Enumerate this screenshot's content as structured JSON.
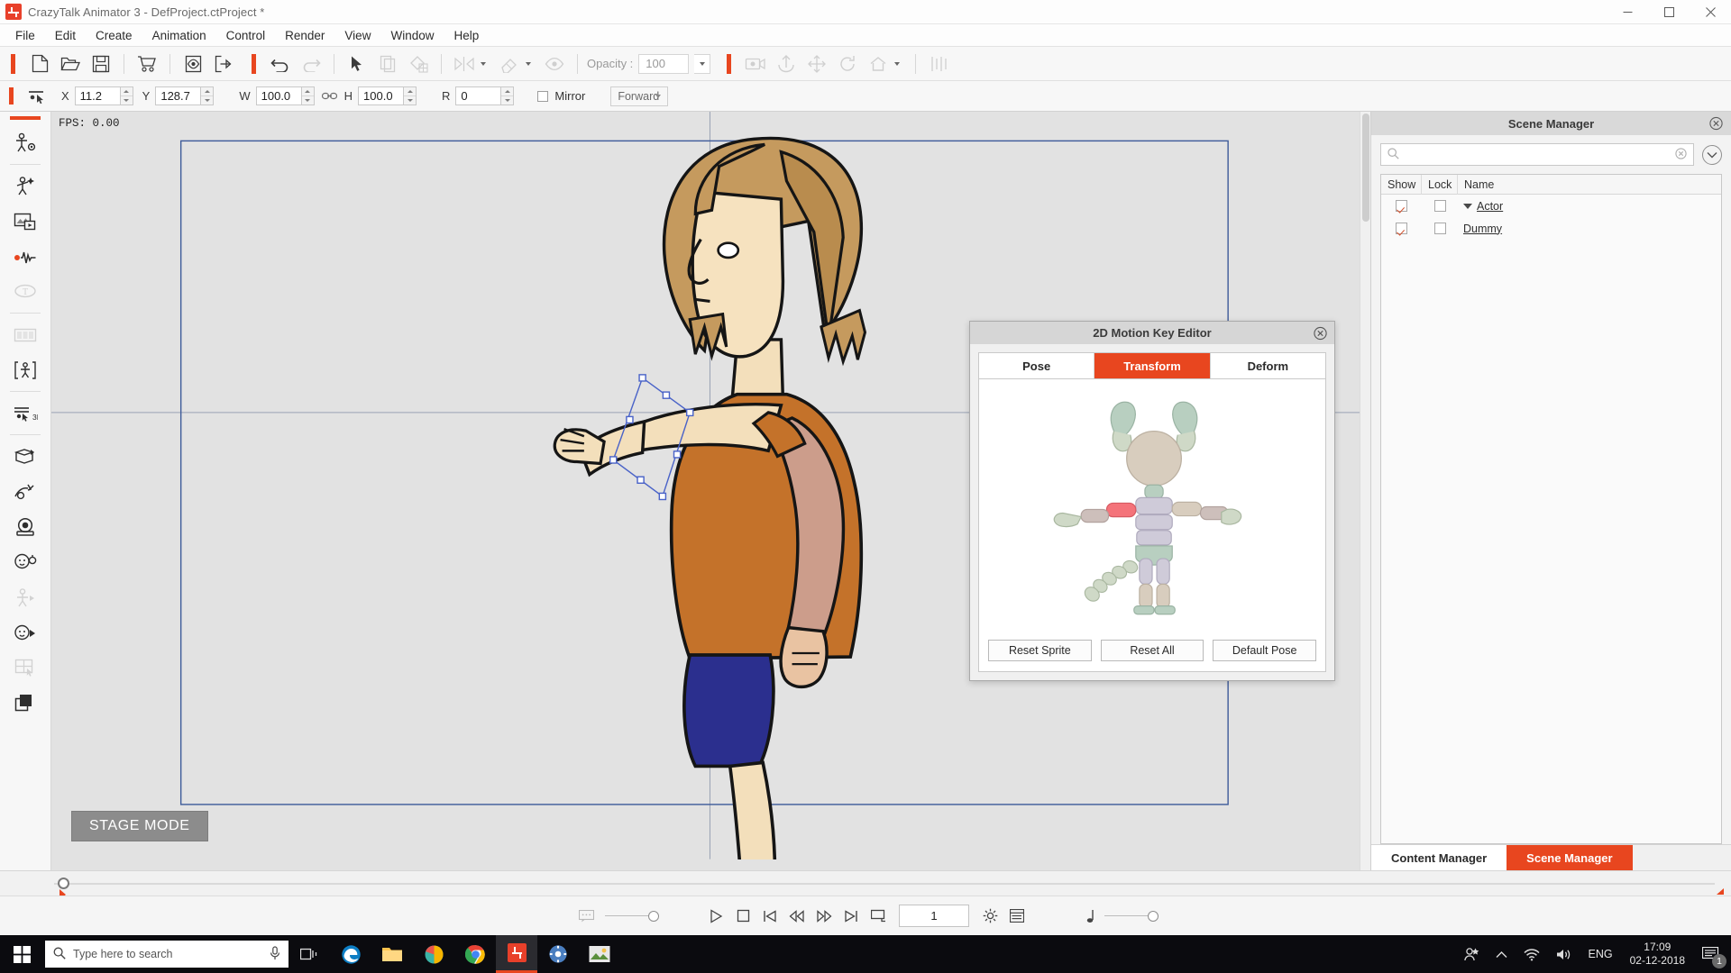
{
  "window": {
    "title": "CrazyTalk Animator 3   - DefProject.ctProject *",
    "minimize_label": "minimize",
    "maximize_label": "maximize",
    "close_label": "close"
  },
  "menu": {
    "items": [
      {
        "label": "File"
      },
      {
        "label": "Edit"
      },
      {
        "label": "Create"
      },
      {
        "label": "Animation"
      },
      {
        "label": "Control"
      },
      {
        "label": "Render"
      },
      {
        "label": "View"
      },
      {
        "label": "Window"
      },
      {
        "label": "Help"
      }
    ]
  },
  "toolbar_main": {
    "opacity_label": "Opacity :",
    "opacity_value": "100",
    "buttons": [
      {
        "name": "new-project-icon",
        "enabled": true
      },
      {
        "name": "open-project-icon",
        "enabled": true
      },
      {
        "name": "save-project-icon",
        "enabled": true
      },
      {
        "name": "marketplace-cart-icon",
        "enabled": true
      },
      {
        "name": "preview-icon",
        "enabled": true
      },
      {
        "name": "export-icon",
        "enabled": true
      },
      {
        "name": "undo-icon",
        "enabled": true
      },
      {
        "name": "redo-icon",
        "enabled": false
      },
      {
        "name": "select-arrow-icon",
        "enabled": true
      },
      {
        "name": "duplicate-icon",
        "enabled": false
      },
      {
        "name": "paint-fill-icon",
        "enabled": false
      },
      {
        "name": "flip-icon",
        "enabled": false
      },
      {
        "name": "eraser-icon",
        "enabled": false
      },
      {
        "name": "eye-visibility-icon",
        "enabled": false
      },
      {
        "name": "camera-view-icon",
        "enabled": false
      },
      {
        "name": "anchor-icon",
        "enabled": false
      },
      {
        "name": "move-icon",
        "enabled": false
      },
      {
        "name": "rotate-icon",
        "enabled": false
      },
      {
        "name": "home-view-icon",
        "enabled": false
      },
      {
        "name": "align-icon",
        "enabled": false
      }
    ]
  },
  "transform_bar": {
    "x_label": "X",
    "x_value": "11.2",
    "y_label": "Y",
    "y_value": "128.7",
    "w_label": "W",
    "w_value": "100.0",
    "h_label": "H",
    "h_value": "100.0",
    "r_label": "R",
    "r_value": "0",
    "mirror_label": "Mirror",
    "mirror_checked": false,
    "direction_value": "Forward"
  },
  "left_toolbar": {
    "items": [
      {
        "name": "actor-composer-icon",
        "enabled": true
      },
      {
        "name": "actor-puppet-icon",
        "enabled": true
      },
      {
        "name": "media-prop-icon",
        "enabled": true
      },
      {
        "name": "audio-record-icon",
        "enabled": true
      },
      {
        "name": "text-bubble-icon",
        "enabled": false
      },
      {
        "name": "sprite-sheet-icon",
        "enabled": false
      },
      {
        "name": "bone-editor-icon",
        "enabled": true
      },
      {
        "name": "3d-motion-icon",
        "enabled": true
      },
      {
        "name": "transform-3d-icon",
        "enabled": true
      },
      {
        "name": "elastic-motion-icon",
        "enabled": true
      },
      {
        "name": "camera-icon",
        "enabled": true
      },
      {
        "name": "face-puppet-icon",
        "enabled": true
      },
      {
        "name": "motion-puppet-icon",
        "enabled": false
      },
      {
        "name": "face-key-icon",
        "enabled": true
      },
      {
        "name": "sprite-grid-icon",
        "enabled": false
      },
      {
        "name": "layer-order-icon",
        "enabled": true
      }
    ]
  },
  "stage": {
    "fps_label": "FPS: 0.00",
    "mode_label": "STAGE MODE"
  },
  "dialog": {
    "title": "2D Motion Key Editor",
    "tabs": [
      {
        "label": "Pose",
        "active": false
      },
      {
        "label": "Transform",
        "active": true
      },
      {
        "label": "Deform",
        "active": false
      }
    ],
    "buttons": [
      {
        "label": "Reset Sprite"
      },
      {
        "label": "Reset All"
      },
      {
        "label": "Default Pose"
      }
    ],
    "selected_sprite_color": "#f4737a",
    "accent_color": "#e8461f"
  },
  "scene_manager": {
    "title": "Scene Manager",
    "search_placeholder": "",
    "search_value": "",
    "columns": [
      {
        "label": "Show"
      },
      {
        "label": "Lock"
      },
      {
        "label": "Name"
      }
    ],
    "rows": [
      {
        "name": "Actor",
        "show": true,
        "lock": false,
        "expanded": true,
        "indent": 0
      },
      {
        "name": "Dummy",
        "show": true,
        "lock": false,
        "expanded": false,
        "indent": 1
      }
    ],
    "tabs": [
      {
        "label": "Content Manager",
        "active": false
      },
      {
        "label": "Scene Manager",
        "active": true
      }
    ]
  },
  "transport": {
    "frame_value": "1",
    "buttons": [
      {
        "name": "play-icon"
      },
      {
        "name": "stop-icon"
      },
      {
        "name": "jump-to-start-icon"
      },
      {
        "name": "previous-frame-icon"
      },
      {
        "name": "next-frame-icon"
      },
      {
        "name": "jump-to-end-icon"
      },
      {
        "name": "loop-icon"
      },
      {
        "name": "render-settings-icon"
      },
      {
        "name": "timeline-icon"
      }
    ]
  },
  "taskbar": {
    "search_placeholder": "Type here to search",
    "language": "ENG",
    "time": "17:09",
    "date": "02-12-2018",
    "notification_count": "1",
    "apps": [
      {
        "name": "task-view-icon"
      },
      {
        "name": "edge-browser-icon"
      },
      {
        "name": "file-explorer-icon"
      },
      {
        "name": "paint3d-icon"
      },
      {
        "name": "chrome-icon"
      },
      {
        "name": "crazytalk-animator-icon"
      },
      {
        "name": "settings-icon"
      },
      {
        "name": "photos-icon"
      }
    ]
  }
}
